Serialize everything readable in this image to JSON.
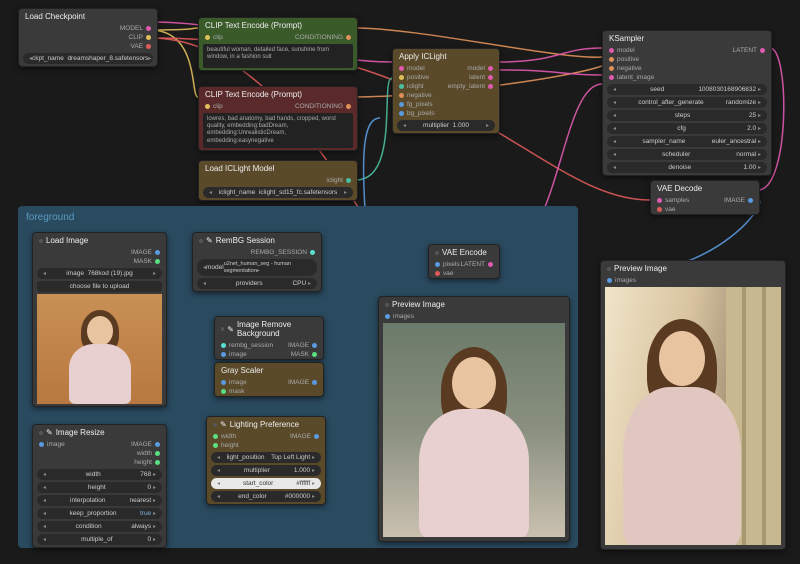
{
  "group": {
    "foreground": "foreground"
  },
  "loadCheckpoint": {
    "title": "Load Checkpoint",
    "out_model": "MODEL",
    "out_clip": "CLIP",
    "out_vae": "VAE",
    "ckpt_label": "ckpt_name",
    "ckpt_value": "dreamshaper_8.safetensors"
  },
  "clipPos": {
    "title": "CLIP Text Encode (Prompt)",
    "in_clip": "clip",
    "out_cond": "CONDITIONING",
    "text": "beautiful woman, detailed face, sunshine from window, in a fashion suit"
  },
  "clipNeg": {
    "title": "CLIP Text Encode (Prompt)",
    "in_clip": "clip",
    "out_cond": "CONDITIONING",
    "text": "lowres, bad anatomy, bad hands, cropped, worst quality, embedding:badDream, embedding:UnrealisticDream, embedding:easynegative"
  },
  "applyIC": {
    "title": "Apply ICLight",
    "in_model": "model",
    "in_iclight": "iclight",
    "in_fg": "fg_pixels",
    "in_bg": "bg_pixels",
    "out_model": "model",
    "out_latent": "latent",
    "out_eb": "empty_latent",
    "mult_label": "multiplier",
    "mult_value": "1.000"
  },
  "loadIC": {
    "title": "Load ICLight Model",
    "out": "iclight",
    "name_label": "iclight_name",
    "name_value": "iclight_sd15_fc.safetensors"
  },
  "ksampler": {
    "title": "KSampler",
    "in_model": "model",
    "in_positive": "positive",
    "in_negative": "negative",
    "in_latent": "latent_image",
    "out_latent": "LATENT",
    "seed_label": "seed",
    "seed_value": "1008030168906832",
    "ctrl_label": "control_after_generate",
    "ctrl_value": "randomize",
    "steps_label": "steps",
    "steps_value": "25",
    "cfg_label": "cfg",
    "cfg_value": "2.0",
    "sampler_label": "sampler_name",
    "sampler_value": "euler_ancestral",
    "sched_label": "scheduler",
    "sched_value": "normal",
    "den_label": "denoise",
    "den_value": "1.00"
  },
  "vaeDecode": {
    "title": "VAE Decode",
    "in_samples": "samples",
    "in_vae": "vae",
    "out": "IMAGE"
  },
  "loadImage": {
    "title": "Load Image",
    "out_image": "IMAGE",
    "out_mask": "MASK",
    "image_label": "image",
    "image_value": "768kod (19).jpg",
    "upload": "choose file to upload"
  },
  "remBG": {
    "title": "RemBG Session",
    "out": "REMBG_SESSION",
    "model_label": "model",
    "model_value": "u2net_human_seg - human segmentation",
    "prov_label": "providers",
    "prov_value": "CPU"
  },
  "imgRB": {
    "title": "Image Remove Background",
    "in_sess": "rembg_session",
    "in_image": "image",
    "out_image": "IMAGE",
    "out_mask": "MASK"
  },
  "gray": {
    "title": "Gray Scaler",
    "in_image": "image",
    "in_mask": "mask",
    "out": "IMAGE"
  },
  "vaeEncode": {
    "title": "VAE Encode",
    "in_pixels": "pixels",
    "in_vae": "vae",
    "out": "LATENT"
  },
  "previewImage": {
    "title": "Preview Image",
    "in": "images"
  },
  "imgResize": {
    "title": "Image Resize",
    "in_image": "image",
    "out_image": "IMAGE",
    "out_w": "width",
    "out_h": "height",
    "w_label": "width",
    "w_value": "768",
    "h_label": "height",
    "h_value": "0",
    "interp_label": "interpolation",
    "interp_value": "nearest",
    "keep_label": "keep_proportion",
    "keep_value": "true",
    "cond_label": "condition",
    "cond_value": "always",
    "mult_label": "multiple_of",
    "mult_value": "0"
  },
  "lightPref": {
    "title": "Lighting Preference",
    "in_w": "width",
    "in_h": "height",
    "out": "IMAGE",
    "pos_label": "light_position",
    "pos_value": "Top Left Light",
    "mult_label": "multiplier",
    "mult_value": "1.000",
    "start_label": "start_color",
    "start_value": "#ffffff",
    "end_label": "end_color",
    "end_value": "#000000"
  }
}
